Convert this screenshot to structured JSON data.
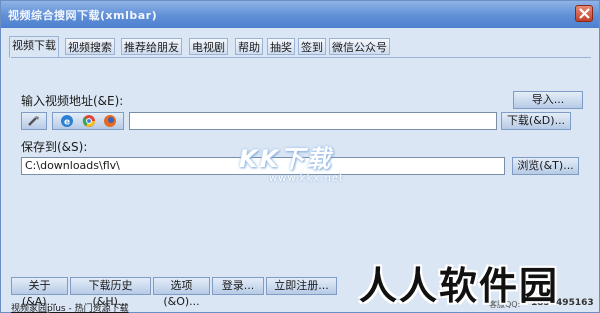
{
  "window": {
    "title": "视频综合搜网下载(xmlbar)"
  },
  "tabs": [
    {
      "label": "视频下载",
      "active": true
    },
    {
      "label": "视频搜索"
    },
    {
      "label": "推荐给朋友"
    },
    {
      "label": "电视剧"
    },
    {
      "label": "帮助"
    },
    {
      "label": "抽奖"
    },
    {
      "label": "签到"
    },
    {
      "label": "微信公众号"
    }
  ],
  "download": {
    "url_label": "输入视频地址(&E):",
    "url_value": "",
    "import_button": "导入...",
    "download_button": "下载(&D)...",
    "save_label": "保存到(&S):",
    "save_path": "C:\\downloads\\flv\\",
    "browse_button": "浏览(&T)..."
  },
  "toolbar_icons": [
    "tools-icon",
    "ie-icon",
    "chrome-icon",
    "firefox-icon"
  ],
  "watermark": {
    "text": "KK下载",
    "url": "www.kkx.net"
  },
  "bottom_buttons": [
    {
      "label": "关于(&A)..."
    },
    {
      "label": "下载历史(&H)..."
    },
    {
      "label": "选项(&O)..."
    },
    {
      "label": "登录..."
    },
    {
      "label": "立即注册..."
    }
  ],
  "status": {
    "link": "视频家园plus - 热门资源下载",
    "qq_label": "客服QQ:",
    "qq_number": "1859495163"
  },
  "logo": {
    "text": "人人软件园"
  },
  "colors": {
    "title_bar": "#5f8fd6",
    "background": "#dbe6f4",
    "close": "#c1412b"
  }
}
